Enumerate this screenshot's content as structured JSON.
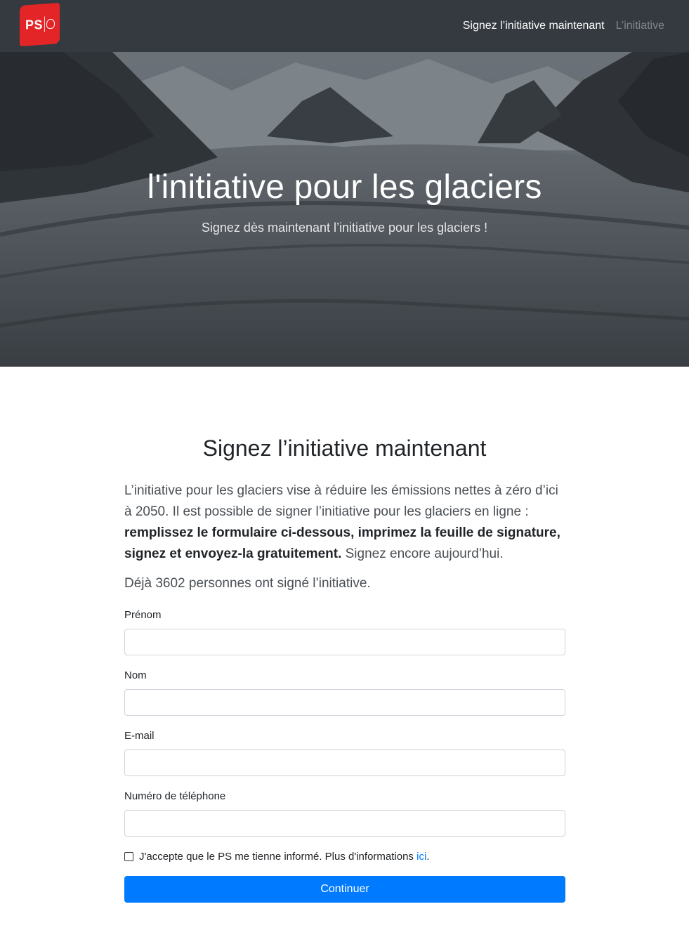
{
  "navbar": {
    "logo_text": "PS",
    "links": [
      {
        "label": "Signez l’initiative maintenant",
        "active": true
      },
      {
        "label": "L’initiative",
        "active": false
      }
    ]
  },
  "hero": {
    "title": "l'initiative pour les glaciers",
    "subtitle": "Signez dès maintenant l’initiative pour les glaciers !"
  },
  "main": {
    "title": "Signez l’initiative maintenant",
    "intro": {
      "part1": "L’initiative pour les glaciers vise à réduire les émissions nettes à zéro d’ici à 2050. Il est possible de signer l’initiative pour les glaciers en ligne : ",
      "bold": "remplissez le formulaire ci-dessous, imprimez la feuille de signature, signez et envoyez-la gratuitement.",
      "part2": " Signez encore aujourd’hui."
    },
    "count_text": "Déjà 3602 personnes ont signé l’initiative."
  },
  "form": {
    "fields": [
      {
        "label": "Prénom",
        "value": "",
        "placeholder": ""
      },
      {
        "label": "Nom",
        "value": "",
        "placeholder": ""
      },
      {
        "label": "E-mail",
        "value": "",
        "placeholder": ""
      },
      {
        "label": "Numéro de téléphone",
        "value": "",
        "placeholder": ""
      }
    ],
    "consent": {
      "text": "J'accepte que le PS me tienne informé. Plus d'informations ",
      "link": "ici",
      "suffix": ".",
      "checked": false
    },
    "submit_label": "Continuer"
  },
  "colors": {
    "navbar": "#343a40",
    "brand_red": "#e42528",
    "primary": "#007bff"
  }
}
